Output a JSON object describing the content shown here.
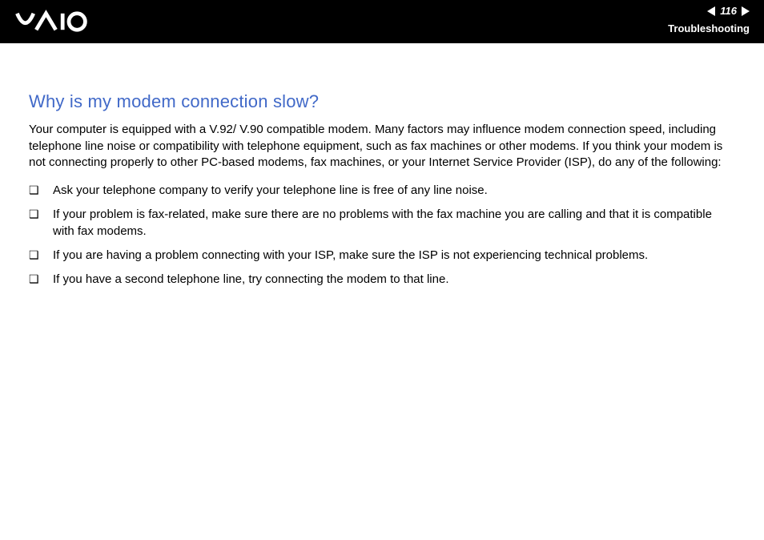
{
  "header": {
    "page_number": "116",
    "section": "Troubleshooting"
  },
  "content": {
    "title": "Why is my modem connection slow?",
    "intro": "Your computer is equipped with a V.92/ V.90 compatible modem. Many factors may influence modem connection speed, including telephone line noise or compatibility with telephone equipment, such as fax machines or other modems. If you think your modem is not connecting properly to other PC-based modems, fax machines, or your Internet Service Provider (ISP), do any of the following:",
    "bullets": [
      "Ask your telephone company to verify your telephone line is free of any line noise.",
      "If your problem is fax-related, make sure there are no problems with the fax machine you are calling and that it is compatible with fax modems.",
      "If you are having a problem connecting with your ISP, make sure the ISP is not experiencing technical problems.",
      "If you have a second telephone line, try connecting the modem to that line."
    ]
  }
}
